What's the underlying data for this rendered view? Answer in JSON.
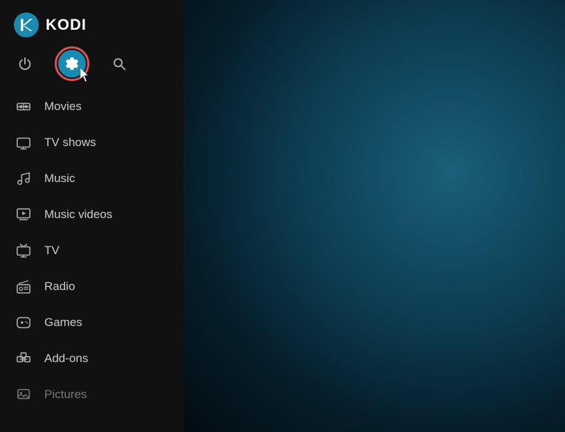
{
  "app": {
    "title": "KODI"
  },
  "topBar": {
    "power_label": "⏻",
    "settings_label": "⚙",
    "search_label": "🔍"
  },
  "nav": {
    "items": [
      {
        "id": "movies",
        "label": "Movies",
        "icon": "movies"
      },
      {
        "id": "tv-shows",
        "label": "TV shows",
        "icon": "tv"
      },
      {
        "id": "music",
        "label": "Music",
        "icon": "music"
      },
      {
        "id": "music-videos",
        "label": "Music videos",
        "icon": "music-videos"
      },
      {
        "id": "tv",
        "label": "TV",
        "icon": "tv2"
      },
      {
        "id": "radio",
        "label": "Radio",
        "icon": "radio"
      },
      {
        "id": "games",
        "label": "Games",
        "icon": "games"
      },
      {
        "id": "add-ons",
        "label": "Add-ons",
        "icon": "addons"
      },
      {
        "id": "pictures",
        "label": "Pictures",
        "icon": "pictures"
      }
    ]
  },
  "colors": {
    "settings_active_bg": "#1a8bb0",
    "settings_active_outline": "#e05050",
    "nav_icon": "#aaaaaa",
    "nav_text": "#cccccc"
  }
}
